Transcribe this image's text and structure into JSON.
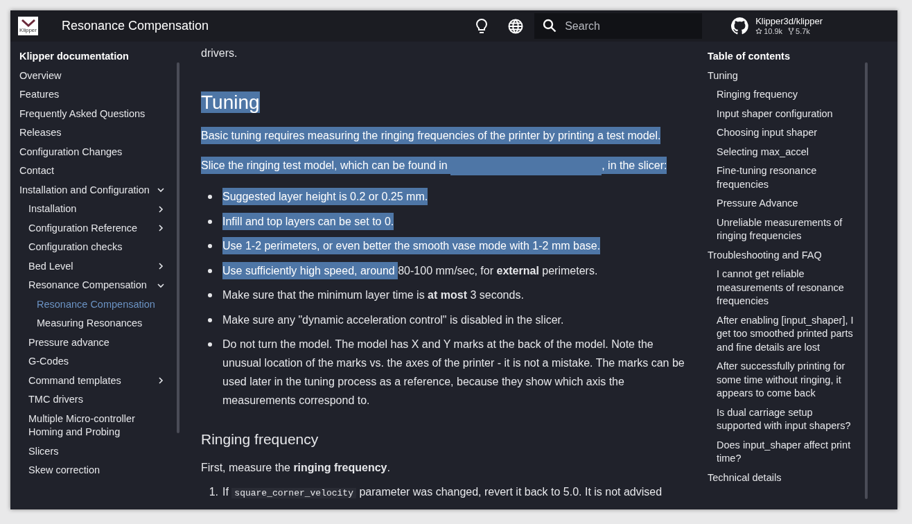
{
  "header": {
    "logo_text": "Klipper",
    "title": "Resonance Compensation",
    "search": {
      "placeholder": "Search"
    },
    "repo": {
      "name": "Klipper3d/klipper",
      "stars": "10.9k",
      "forks": "5.7k"
    }
  },
  "sidebar": {
    "heading": "Klipper documentation",
    "items": [
      {
        "label": "Overview",
        "selected": false
      },
      {
        "label": "Features",
        "selected": false
      },
      {
        "label": "Frequently Asked Questions",
        "selected": false
      },
      {
        "label": "Releases",
        "selected": false
      },
      {
        "label": "Configuration Changes",
        "selected": false
      },
      {
        "label": "Contact",
        "selected": false
      },
      {
        "label": "Installation and Configuration",
        "selected": false,
        "expanded": true,
        "children": [
          {
            "label": "Installation",
            "selected": false,
            "expanded": false
          },
          {
            "label": "Configuration Reference",
            "selected": false,
            "expanded": false
          },
          {
            "label": "Configuration checks",
            "selected": false
          },
          {
            "label": "Bed Level",
            "selected": false,
            "expanded": false
          },
          {
            "label": "Resonance Compensation",
            "selected": false,
            "expanded": true,
            "children": [
              {
                "label": "Resonance Compensation",
                "selected": true
              },
              {
                "label": "Measuring Resonances",
                "selected": false
              }
            ]
          },
          {
            "label": "Pressure advance",
            "selected": false
          },
          {
            "label": "G-Codes",
            "selected": false
          },
          {
            "label": "Command templates",
            "selected": false,
            "expanded": false
          },
          {
            "label": "TMC drivers",
            "selected": false
          },
          {
            "label": "Multiple Micro-controller Homing and Probing",
            "selected": false
          },
          {
            "label": "Slicers",
            "selected": false
          },
          {
            "label": "Skew correction",
            "selected": false
          }
        ]
      }
    ]
  },
  "content": {
    "lead": "drivers.",
    "heading": {
      "text": "Tuning",
      "selected": true
    },
    "paragraphs": [
      {
        "segments": [
          {
            "text": "Basic tuning requires measuring the ringing frequencies of the printer by printing a test model.",
            "selected": true
          }
        ]
      },
      {
        "segments": [
          {
            "text": "Slice the ringing test model, which can be found in ",
            "selected": true
          },
          {
            "kind": "gap",
            "selected": true
          },
          {
            "text": ", in the slicer:",
            "selected": true
          }
        ]
      }
    ],
    "bullets": [
      {
        "segments": [
          {
            "text": "Suggested layer height is 0.2 or 0.25 mm.",
            "selected": true
          }
        ]
      },
      {
        "segments": [
          {
            "text": "Infill and top layers can be set to 0.",
            "selected": true
          }
        ]
      },
      {
        "segments": [
          {
            "text": "Use 1-2 perimeters, or even better the smooth vase mode with 1-2 mm base.",
            "selected": true
          }
        ]
      },
      {
        "segments": [
          {
            "text": "Use sufficiently high speed, around ",
            "selected": true
          },
          {
            "text": "80-100 mm/sec, for **external** perimeters.",
            "selected": false
          }
        ]
      },
      {
        "segments": [
          {
            "text": "Make sure that the minimum layer time is **at most** 3 seconds.",
            "selected": false
          }
        ]
      },
      {
        "segments": [
          {
            "text": "Make sure any \"dynamic acceleration control\" is disabled in the slicer.",
            "selected": false
          }
        ]
      },
      {
        "segments": [
          {
            "text": "Do not turn the model. The model has X and Y marks at the back of the model. Note the unusual location of the marks vs. the axes of the printer - it is not a mistake. The marks can be used later in the tuning process as a reference, because they show which axis the measurements correspond to.",
            "selected": false
          }
        ]
      }
    ],
    "subheading": "Ringing frequency",
    "intro": "First, measure the **ringing frequency**.",
    "steps": [
      {
        "number": "1.",
        "before": "If ",
        "code": "square_corner_velocity",
        "after": " parameter was changed, revert it back to 5.0. It is not advised"
      }
    ]
  },
  "toc": {
    "heading": "Table of contents",
    "items": [
      {
        "label": "Tuning",
        "children": [
          {
            "label": "Ringing frequency"
          },
          {
            "label": "Input shaper configuration"
          },
          {
            "label": "Choosing input shaper"
          },
          {
            "label": "Selecting max_accel"
          },
          {
            "label": "Fine-tuning resonance frequencies"
          },
          {
            "label": "Pressure Advance"
          },
          {
            "label": "Unreliable measurements of ringing frequencies"
          }
        ]
      },
      {
        "label": "Troubleshooting and FAQ",
        "children": [
          {
            "label": "I cannot get reliable measurements of resonance frequencies"
          },
          {
            "label": "After enabling [input_shaper], I get too smoothed printed parts and fine details are lost"
          },
          {
            "label": "After successfully printing for some time without ringing, it appears to come back"
          },
          {
            "label": "Is dual carriage setup supported with input shapers?"
          },
          {
            "label": "Does input_shaper affect print time?"
          }
        ]
      },
      {
        "label": "Technical details"
      }
    ]
  }
}
